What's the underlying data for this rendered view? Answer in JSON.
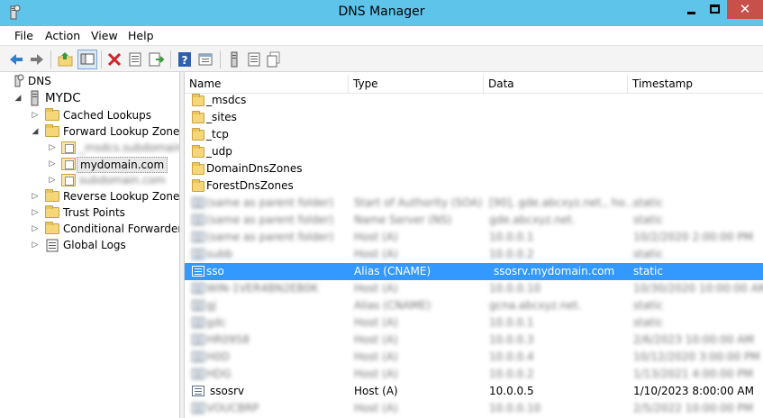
{
  "window": {
    "title": "DNS Manager",
    "close_glyph": "✕",
    "icons": {
      "app": "dns-server-icon",
      "minimize": "minimize-icon",
      "maximize": "maximize-icon",
      "close": "close-icon"
    }
  },
  "menu": {
    "items": [
      "File",
      "Action",
      "View",
      "Help"
    ]
  },
  "toolbar": {
    "buttons": [
      "back-arrow-icon",
      "forward-arrow-icon",
      "up-folder-icon",
      "show-hide-tree-icon",
      "delete-icon",
      "properties-icon",
      "export-list-icon",
      "help-icon",
      "view-icon",
      "server-icon",
      "record-list-icon",
      "record-details-icon"
    ]
  },
  "tree": {
    "root": "DNS",
    "server": "MYDC",
    "items": {
      "cached": "Cached Lookups",
      "forward": "Forward Lookup Zones",
      "zone_blur1": "_msdcs.subdomain.com",
      "zone_selected": "mydomain.com",
      "zone_blur2": "subdomain.com",
      "reverse": "Reverse Lookup Zones",
      "trust": "Trust Points",
      "conditional": "Conditional Forwarders",
      "global": "Global Logs"
    }
  },
  "list": {
    "columns": [
      "Name",
      "Type",
      "Data",
      "Timestamp"
    ],
    "folders": [
      "_msdcs",
      "_sites",
      "_tcp",
      "_udp",
      "DomainDnsZones",
      "ForestDnsZones"
    ],
    "blurred_rows_top": [
      [
        "(same as parent folder)",
        "Start of Authority (SOA)",
        "[90], gde.abcxyz.net., ho...",
        "static"
      ],
      [
        "(same as parent folder)",
        "Name Server (NS)",
        "gde.abcxyz.net.",
        "static"
      ],
      [
        "(same as parent folder)",
        "Host (A)",
        "10.0.0.1",
        "10/2/2020 2:00:00 PM"
      ],
      [
        "subb",
        "Host (A)",
        "10.0.0.2",
        "static"
      ]
    ],
    "selected_row": [
      "sso",
      "Alias (CNAME)",
      "ssosrv.mydomain.com",
      "static"
    ],
    "blurred_rows_mid": [
      [
        "WIN-1VER4BN2EB0K",
        "Host (A)",
        "10.0.0.10",
        "10/30/2020 10:00:00 AM"
      ],
      [
        "gj",
        "Alias (CNAME)",
        "gcna.abcxyz.net.",
        "static"
      ],
      [
        "gdc",
        "Host (A)",
        "10.0.0.1",
        "static"
      ],
      [
        "HR0958",
        "Host (A)",
        "10.0.0.3",
        "2/6/2023 10:00:00 AM"
      ],
      [
        "H0D",
        "Host (A)",
        "10.0.0.4",
        "10/12/2020 3:00:00 PM"
      ],
      [
        "HDG",
        "Host (A)",
        "10.0.0.2",
        "1/13/2021 4:00:00 PM"
      ]
    ],
    "highlight_row": [
      "ssosrv",
      "Host (A)",
      "10.0.0.5",
      "1/10/2023 8:00:00 AM"
    ],
    "blurred_rows_bottom": [
      [
        "VOUCBRP",
        "Host (A)",
        "10.0.0.10",
        "2/5/2022 10:00:00 PM"
      ]
    ]
  }
}
